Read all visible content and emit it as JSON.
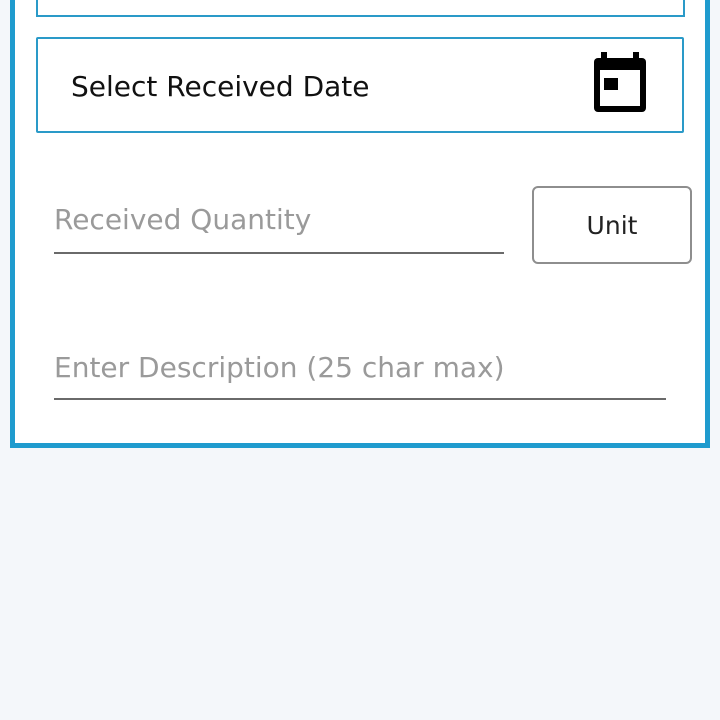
{
  "form": {
    "date_field": {
      "label": "Select Received Date",
      "icon": "calendar-icon"
    },
    "quantity_field": {
      "placeholder": "Received Quantity",
      "value": ""
    },
    "unit_button": {
      "label": "Unit"
    },
    "description_field": {
      "placeholder": "Enter Description (25 char max)",
      "value": ""
    }
  },
  "colors": {
    "accent": "#1f9bce",
    "background": "#f4f7fa",
    "card": "#ffffff",
    "placeholder": "#9a9a9a"
  }
}
